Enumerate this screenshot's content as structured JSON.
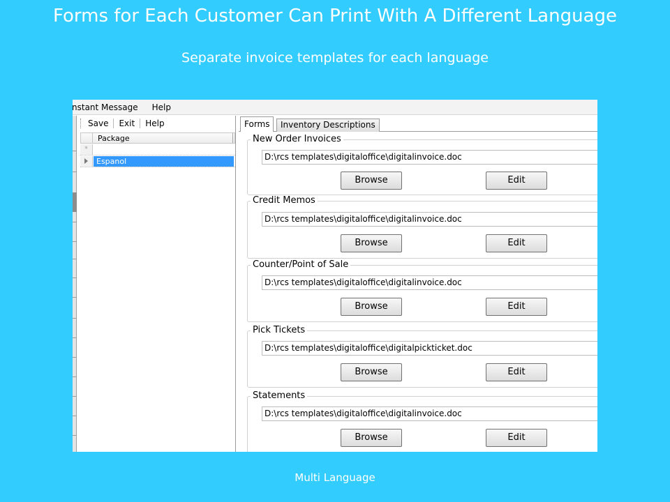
{
  "slide": {
    "title": "Forms for Each Customer Can Print With A Different Language",
    "subtitle": "Separate  invoice templates for each language",
    "footer": "Multi Language"
  },
  "menu": {
    "items": [
      "nstant Message",
      "Help"
    ]
  },
  "toolbar": {
    "save_label": "Save",
    "exit_label": "Exit",
    "help_label": "Help"
  },
  "grid": {
    "column_header": "Package",
    "new_row_marker": "*",
    "rows": [
      {
        "package": "Espanol",
        "selected": true
      }
    ]
  },
  "tabs": [
    {
      "label": "Forms",
      "active": true
    },
    {
      "label": "Inventory Descriptions",
      "active": false
    }
  ],
  "form_groups": [
    {
      "label": "New Order Invoices",
      "path": "D:\\rcs templates\\digitaloffice\\digitalinvoice.doc",
      "browse_label": "Browse",
      "edit_label": "Edit"
    },
    {
      "label": "Credit Memos",
      "path": "D:\\rcs templates\\digitaloffice\\digitalinvoice.doc",
      "browse_label": "Browse",
      "edit_label": "Edit"
    },
    {
      "label": "Counter/Point of Sale",
      "path": "D:\\rcs templates\\digitaloffice\\digitalinvoice.doc",
      "browse_label": "Browse",
      "edit_label": "Edit"
    },
    {
      "label": "Pick Tickets",
      "path": "D:\\rcs templates\\digitaloffice\\digitalpickticket.doc",
      "browse_label": "Browse",
      "edit_label": "Edit"
    },
    {
      "label": "Statements",
      "path": "D:\\rcs templates\\digitaloffice\\digitalinvoice.doc",
      "browse_label": "Browse",
      "edit_label": "Edit"
    }
  ],
  "colors": {
    "background": "#33ccff",
    "selection": "#3399ff"
  }
}
